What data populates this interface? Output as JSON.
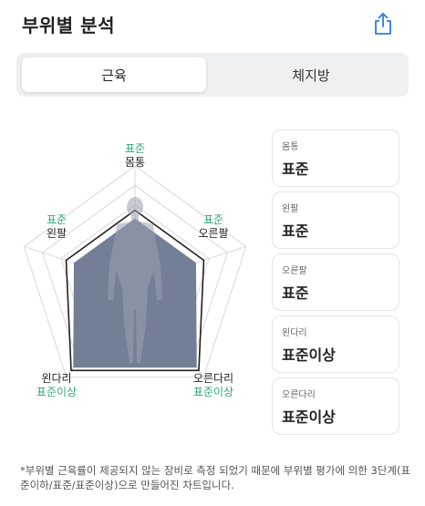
{
  "header": {
    "title": "부위별 분석",
    "share_icon": "share-icon"
  },
  "tabs": [
    {
      "label": "근육",
      "selected": true
    },
    {
      "label": "체지방",
      "selected": false
    }
  ],
  "radar": {
    "axes": [
      {
        "name": "몸통",
        "level": "표준"
      },
      {
        "name": "오른팔",
        "level": "표준"
      },
      {
        "name": "오른다리",
        "level": "표준이상"
      },
      {
        "name": "왼다리",
        "level": "표준이상"
      },
      {
        "name": "왼팔",
        "level": "표준"
      }
    ],
    "colors": {
      "fill": "#6d7a92",
      "label_level": "#2fa978",
      "grid": "#d8d8d8"
    }
  },
  "cards": [
    {
      "name": "몸통",
      "value": "표준"
    },
    {
      "name": "왼팔",
      "value": "표준"
    },
    {
      "name": "오른팔",
      "value": "표준"
    },
    {
      "name": "왼다리",
      "value": "표준이상"
    },
    {
      "name": "오른다리",
      "value": "표준이상"
    }
  ],
  "footnote": "*부위별 근육률이 제공되지 않는 장비로 측정 되었기 때문에 부위별 평가에 의한 3단계(표준이하/표준/표준이상)으로 만들어진 차트입니다."
}
